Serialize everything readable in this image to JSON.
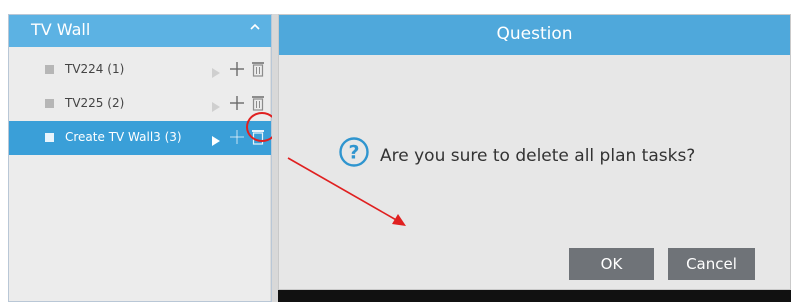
{
  "panel": {
    "title": "TV Wall",
    "items": [
      {
        "label": "TV224 (1)"
      },
      {
        "label": "TV225 (2)"
      },
      {
        "label": "Create TV Wall3 (3)"
      }
    ]
  },
  "dialog": {
    "title": "Question",
    "message": "Are you sure to delete all plan tasks?",
    "ok_label": "OK",
    "cancel_label": "Cancel"
  },
  "icons": [
    "collapse-icon",
    "square-icon",
    "play-icon",
    "plus-icon",
    "trash-icon",
    "question-icon"
  ],
  "colors": {
    "header_blue": "#5cb2e3",
    "active_row": "#3a9fd8",
    "dialog_header": "#4fa8db",
    "button": "#6f7378",
    "annotation_red": "#e02020"
  }
}
